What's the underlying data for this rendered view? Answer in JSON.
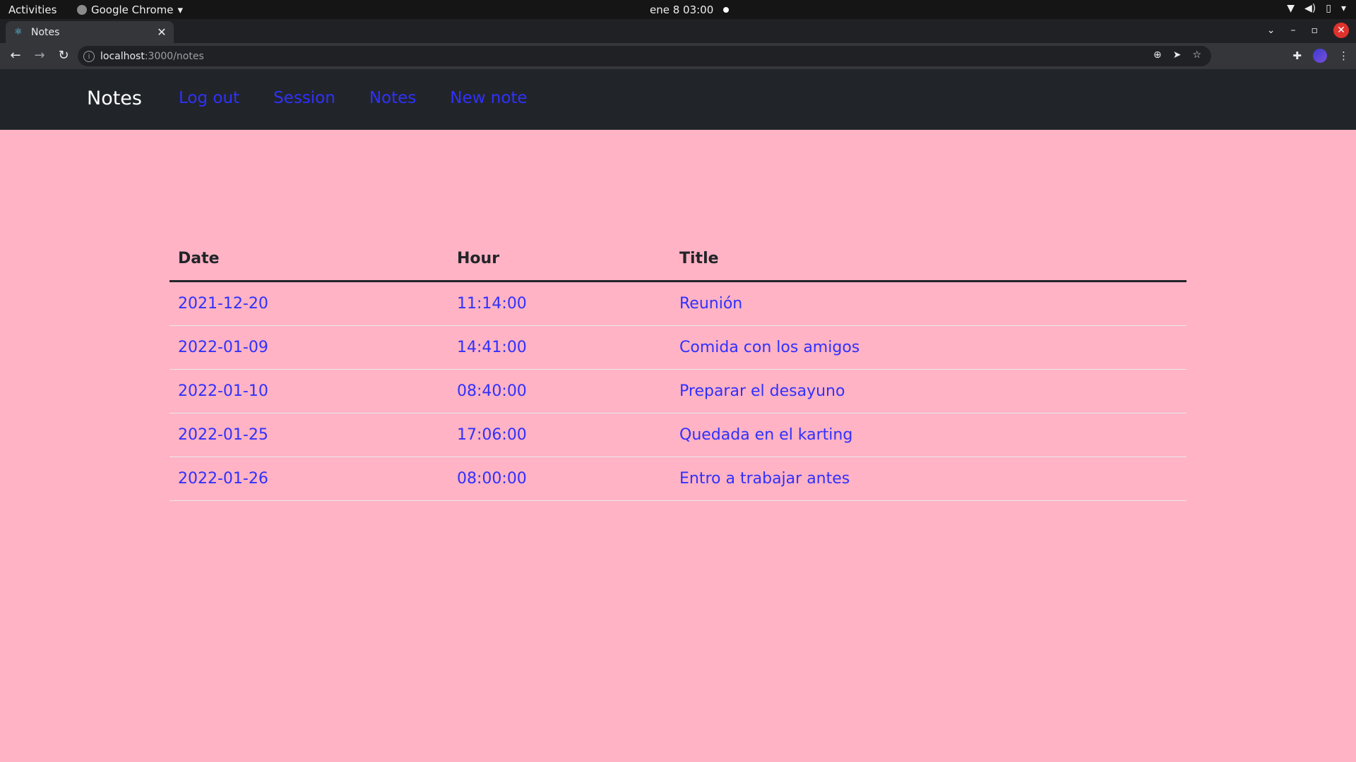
{
  "os_bar": {
    "activities": "Activities",
    "app_name": "Google Chrome",
    "clock": "ene 8  03:00"
  },
  "browser": {
    "tab_title": "Notes",
    "url_host": "localhost",
    "url_path": ":3000/notes"
  },
  "navbar": {
    "brand": "Notes",
    "links": [
      "Log out",
      "Session",
      "Notes",
      "New note"
    ]
  },
  "table": {
    "headers": [
      "Date",
      "Hour",
      "Title"
    ],
    "rows": [
      {
        "date": "2021-12-20",
        "hour": "11:14:00",
        "title": "Reunión"
      },
      {
        "date": "2022-01-09",
        "hour": "14:41:00",
        "title": "Comida con los amigos"
      },
      {
        "date": "2022-01-10",
        "hour": "08:40:00",
        "title": "Preparar el desayuno"
      },
      {
        "date": "2022-01-25",
        "hour": "17:06:00",
        "title": "Quedada en el karting"
      },
      {
        "date": "2022-01-26",
        "hour": "08:00:00",
        "title": "Entro a trabajar antes"
      }
    ]
  },
  "colors": {
    "page_background": "#ffb3c4",
    "navbar_background": "#212529",
    "link": "#3030ff"
  },
  "icons": {
    "tab_favicon": "react-icon",
    "tray": [
      "wifi-icon",
      "volume-icon",
      "battery-icon",
      "chevron-down-icon"
    ],
    "toolbar": [
      "back-icon",
      "forward-icon",
      "reload-icon",
      "info-icon",
      "zoom-icon",
      "send-icon",
      "star-icon",
      "extensions-icon",
      "profile-icon",
      "menu-icon"
    ]
  }
}
